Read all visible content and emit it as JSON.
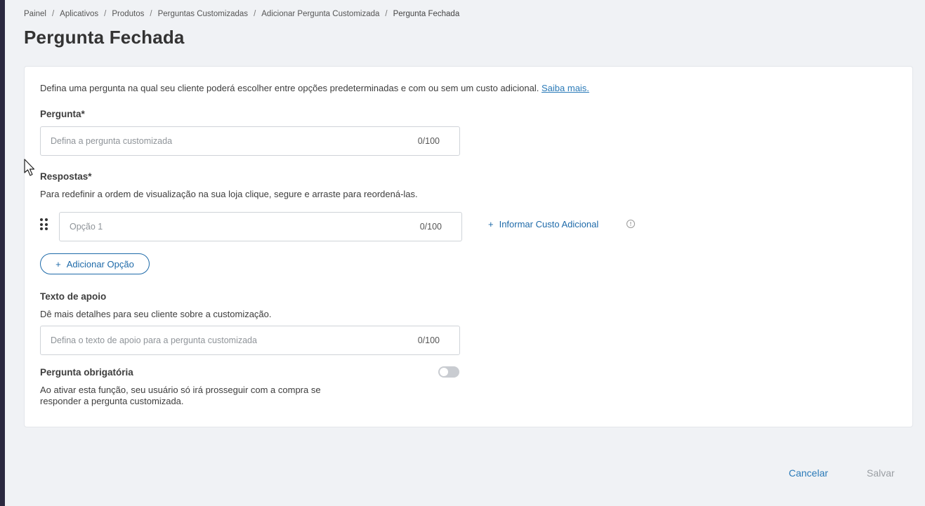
{
  "breadcrumb": [
    {
      "label": "Painel"
    },
    {
      "label": "Aplicativos"
    },
    {
      "label": "Produtos"
    },
    {
      "label": "Perguntas Customizadas"
    },
    {
      "label": "Adicionar Pergunta Customizada"
    },
    {
      "label": "Pergunta Fechada"
    }
  ],
  "breadcrumb_sep": "/",
  "page": {
    "title": "Pergunta Fechada"
  },
  "form": {
    "intro_text": "Defina uma pergunta na qual seu cliente poderá escolher entre opções predeterminadas e com ou sem um custo adicional.",
    "intro_link": "Saiba mais.",
    "question": {
      "label": "Pergunta*",
      "placeholder": "Defina a pergunta customizada",
      "value": "",
      "counter": "0/100"
    },
    "answers": {
      "label": "Respostas*",
      "help": "Para redefinir a ordem de visualização na sua loja clique, segure e arraste para reordená-las.",
      "options": [
        {
          "placeholder": "Opção 1",
          "value": "",
          "counter": "0/100"
        }
      ],
      "extra_cost_label": "Informar Custo Adicional",
      "extra_cost_plus": "+",
      "add_option_label": "Adicionar Opção",
      "add_option_plus": "+"
    },
    "support": {
      "label": "Texto de apoio",
      "help": "Dê mais detalhes para seu cliente sobre a customização.",
      "placeholder": "Defina o texto de apoio para a pergunta customizada",
      "value": "",
      "counter": "0/100"
    },
    "required": {
      "label": "Pergunta obrigatória",
      "help_line1": "Ao ativar esta função, seu usuário só irá prosseguir com a compra se",
      "help_line2": "responder a pergunta customizada.",
      "enabled": false
    }
  },
  "footer": {
    "cancel_label": "Cancelar",
    "save_label": "Salvar"
  },
  "colors": {
    "link": "#2a7ab8",
    "primary": "#1e6aa9",
    "disabled": "#9a9ea3",
    "sidebar": "#2b2940"
  },
  "icons": {
    "drag": "drag-handle-icon",
    "info": "info-icon",
    "plus": "plus-icon"
  }
}
